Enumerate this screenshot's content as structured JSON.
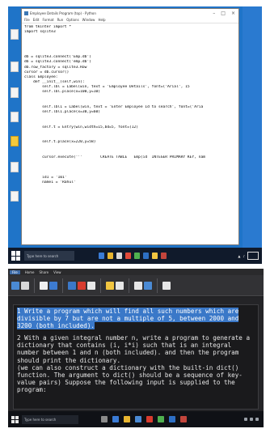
{
  "top": {
    "title": "Employee Details Program (top) - Python",
    "menu": [
      "File",
      "Edit",
      "Format",
      "Run",
      "Options",
      "Window",
      "Help"
    ],
    "code_lines": [
      "from tkinter import *",
      "import sqlite3",
      "",
      "",
      "",
      "",
      "db = sqlite3.connect('Emp.db')",
      "db = sqlite3.connect('emp.db')",
      "db.row_factory = sqlite3.Row",
      "cursor = db.cursor()",
      "class Employee:",
      "    def __init__(self,win):",
      "        self.lbl = Label(win, text = 'Employee Details', font=('Arial', 15",
      "        self.lbl.place(x=100,y=10)",
      "",
      "",
      "        self.lbl1 = Label(win, text = 'Enter Employee Id to search', font=('Aria",
      "        self.lbl1.place(x=30,y=60)",
      "",
      "",
      "        self.t = Entry(win,width=15,bd=5, font=(12)",
      "",
      "",
      "        self.t.place(x=220,y=58)",
      "",
      "",
      "        cursor.execute('''        CREATE TABLE   Emp(id  INTEGER PRIMARY KEY, nam",
      "",
      "",
      "",
      "        id1 = '101'",
      "        name1 = 'Rahul'"
    ],
    "search_placeholder": "Type here to search"
  },
  "bottom": {
    "tabs": [
      "File",
      "Home",
      "Share",
      "View"
    ],
    "search_placeholder": "Type here to search",
    "paragraphs": [
      {
        "selected": true,
        "text": "1 Write a program which will find all such numbers which are divisible by 7 but are not a multiple of 5, between 2000 and 3200 (both included)."
      },
      {
        "selected": false,
        "text": "2 With a given integral number n, write a program to generate a dictionary that contains (i, i*i) such that is an integral number between 1 and n (both included). and then the program should print the dictionary."
      },
      {
        "selected": false,
        "text": "(we can also construct a dictionary with the built-in dict() function. The argument to dict() should be a sequence of key-value pairs) Suppose the following input is supplied to the program:"
      }
    ]
  },
  "colors": {
    "desktop_blue": "#1f74c8",
    "selection_blue": "#3a78c8",
    "keyword_orange": "#ff7700",
    "string_green": "#00aa00"
  }
}
